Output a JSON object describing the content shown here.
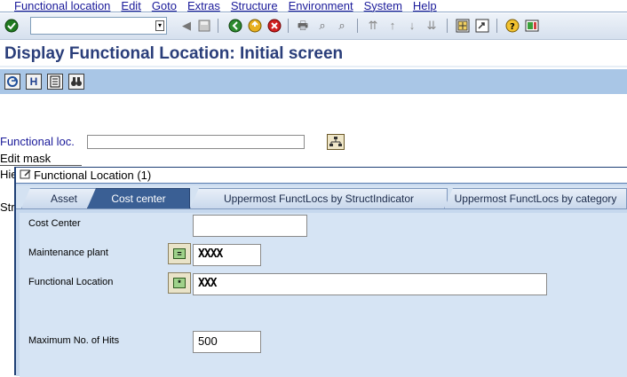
{
  "menu": [
    "Functional location",
    "Edit",
    "Goto",
    "Extras",
    "Structure",
    "Environment",
    "System",
    "Help"
  ],
  "toolbar": {
    "command_value": "",
    "icons": [
      "enter-icon",
      "save-icon",
      "back-icon",
      "exit-icon",
      "cancel-icon",
      "print-icon",
      "find-icon",
      "find-next-icon",
      "first-page-icon",
      "prev-page-icon",
      "next-page-icon",
      "last-page-icon",
      "create-session-icon",
      "shortcut-icon",
      "help-icon",
      "customize-layout-icon"
    ]
  },
  "title": "Display Functional Location: Initial screen",
  "app_toolbar": {
    "icons": [
      "refresh-icon",
      "info-icon",
      "document-icon",
      "binoculars-icon"
    ]
  },
  "selection": {
    "functional_loc_label": "Functional loc.",
    "functional_loc_value": "",
    "edit_mask_label": "Edit mask",
    "hierarchy_label_partial": "Hie",
    "structure_label_partial": "Str"
  },
  "dialog": {
    "title": "Functional Location (1)",
    "tabs": [
      "Asset",
      "Cost center",
      "Uppermost FunctLocs by StructIndicator",
      "Uppermost FunctLocs by category"
    ],
    "active_tab": "Cost center",
    "fields": {
      "cost_center_label": "Cost Center",
      "cost_center_value": "",
      "maintenance_plant_label": "Maintenance plant",
      "maintenance_plant_value": "XXXX",
      "functional_location_label": "Functional Location",
      "functional_location_value": "XXX",
      "max_hits_label": "Maximum No. of Hits",
      "max_hits_value": "500"
    }
  }
}
